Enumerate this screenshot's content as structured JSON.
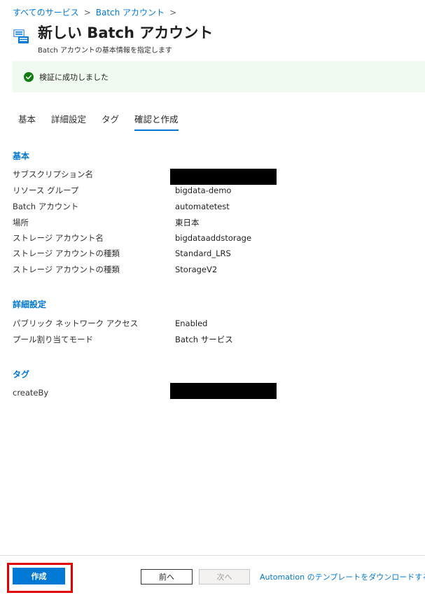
{
  "breadcrumb": {
    "items": [
      "すべてのサービス",
      "Batch アカウント"
    ],
    "separator": ">"
  },
  "header": {
    "title": "新しい Batch アカウント",
    "subtitle": "Batch アカウントの基本情報を指定します",
    "icon": "batch-account-icon"
  },
  "banner": {
    "text": "検証に成功しました",
    "icon": "check-circle-icon",
    "color": "#107c10"
  },
  "tabs": [
    {
      "label": "基本",
      "active": false
    },
    {
      "label": "詳細設定",
      "active": false
    },
    {
      "label": "タグ",
      "active": false
    },
    {
      "label": "確認と作成",
      "active": true
    }
  ],
  "sections": {
    "basics": {
      "title": "基本",
      "rows": [
        {
          "label": "サブスクリプション名",
          "value": ""
        },
        {
          "label": "リソース グループ",
          "value": "bigdata-demo"
        },
        {
          "label": "Batch アカウント",
          "value": "automatetest"
        },
        {
          "label": "場所",
          "value": "東日本"
        },
        {
          "label": "ストレージ アカウント名",
          "value": "bigdataaddstorage"
        },
        {
          "label": "ストレージ アカウントの種類",
          "value": "Standard_LRS"
        },
        {
          "label": "ストレージ アカウントの種類",
          "value": "StorageV2"
        }
      ]
    },
    "advanced": {
      "title": "詳細設定",
      "rows": [
        {
          "label": "パブリック ネットワーク アクセス",
          "value": "Enabled"
        },
        {
          "label": "プール割り当てモード",
          "value": "Batch サービス"
        }
      ]
    },
    "tags": {
      "title": "タグ",
      "rows": [
        {
          "label": "createBy",
          "value": ""
        }
      ]
    }
  },
  "footer": {
    "create_label": "作成",
    "prev_label": "前へ",
    "next_label": "次へ",
    "download_label": "Automation のテンプレートをダウンロードする"
  },
  "colors": {
    "accent": "#0078d4",
    "banner_bg": "#f1faf0",
    "highlight": "#e00000"
  }
}
